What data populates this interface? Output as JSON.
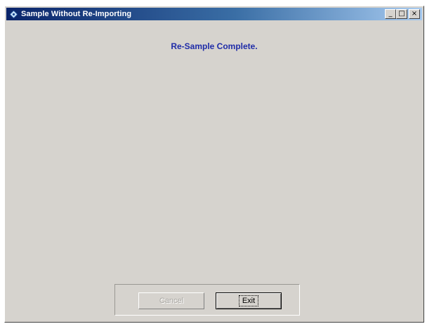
{
  "window": {
    "title": "Sample Without Re-Importing",
    "controls": {
      "minimize_label": "_",
      "maximize_label": "□",
      "close_label": "×"
    }
  },
  "main": {
    "message": "Re-Sample Complete."
  },
  "buttons": {
    "cancel_label": "Cancel",
    "cancel_enabled": false,
    "exit_label": "Exit"
  },
  "colors": {
    "message_text": "#1f2ca8",
    "titlebar_start": "#0a246a",
    "titlebar_end": "#a6caf0",
    "dialog_face": "#d6d3ce"
  },
  "icons": {
    "title_icon": "app-diamond-icon"
  }
}
